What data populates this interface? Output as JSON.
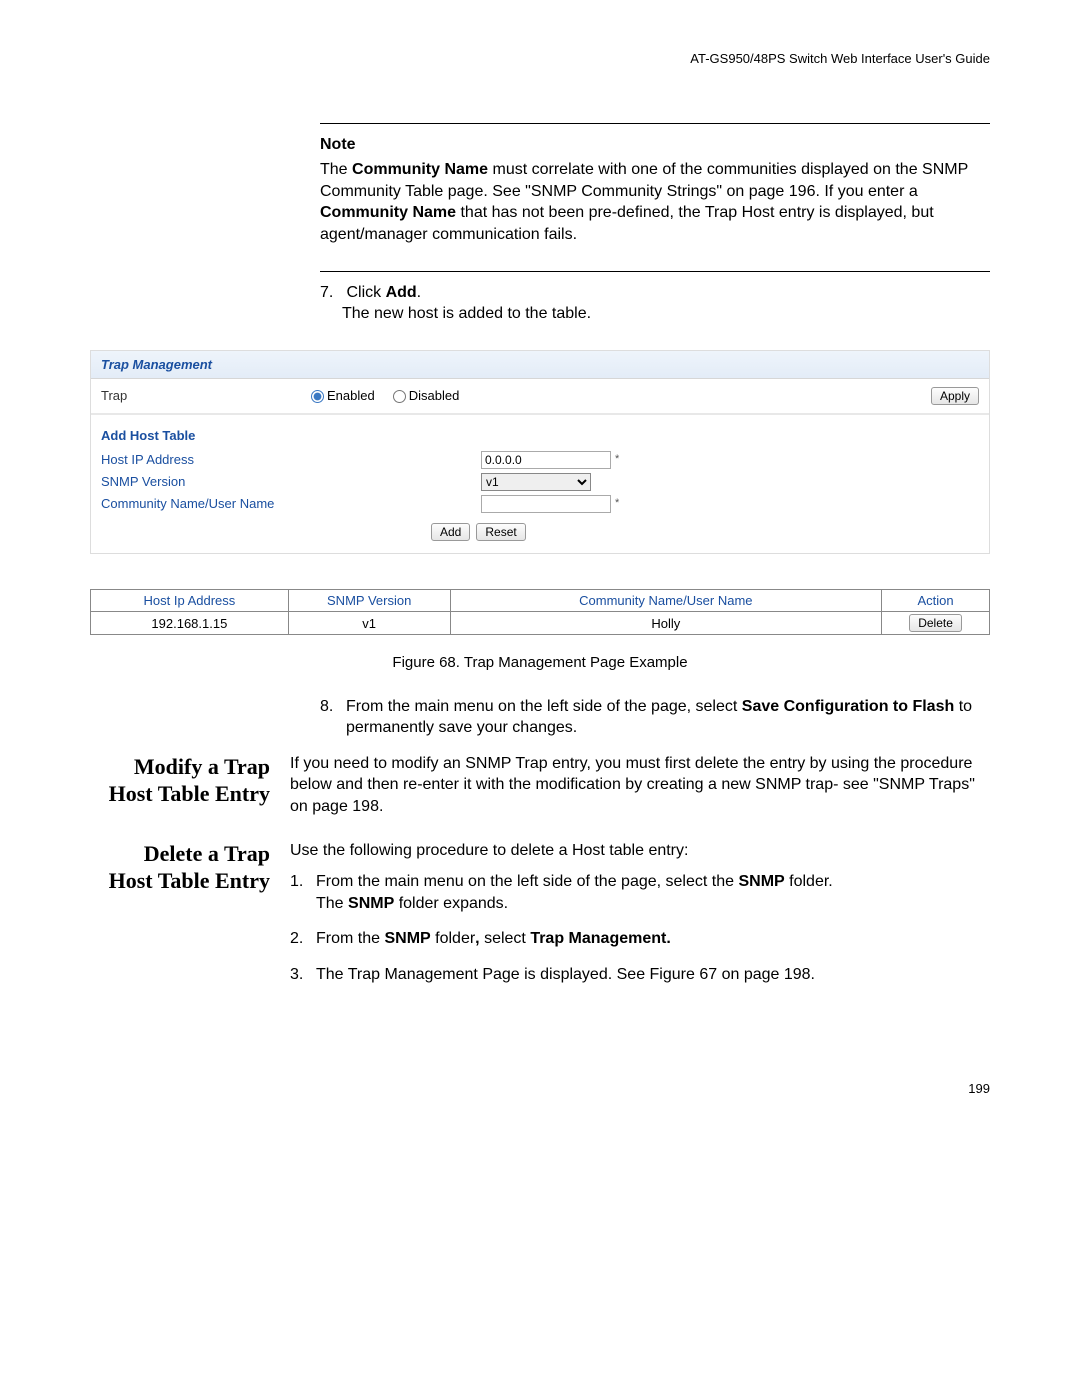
{
  "doc_header": "AT-GS950/48PS Switch Web Interface User's Guide",
  "note": {
    "title": "Note",
    "text_parts": {
      "p1": "The ",
      "b1": "Community Name",
      "p2": " must correlate with one of the communities displayed on the SNMP Community Table page. See \"SNMP Community Strings\" on page 196. If you enter a ",
      "b2": "Community Name",
      "p3": " that has not been pre-defined, the Trap Host entry is displayed, but agent/manager communication fails."
    }
  },
  "step7": {
    "num": "7.",
    "line1a": "Click ",
    "line1b": "Add",
    "line1c": ".",
    "line2": "The new host is added to the table."
  },
  "trap": {
    "title": "Trap Management",
    "trap_label": "Trap",
    "enabled": "Enabled",
    "disabled": "Disabled",
    "apply": "Apply",
    "add_host_title": "Add Host Table",
    "host_ip_label": "Host IP Address",
    "host_ip_value": "0.0.0.0",
    "snmp_version_label": "SNMP Version",
    "snmp_version_value": "v1",
    "community_label": "Community Name/User Name",
    "community_value": "",
    "add_btn": "Add",
    "reset_btn": "Reset",
    "req": "*"
  },
  "table": {
    "headers": {
      "h1": "Host Ip Address",
      "h2": "SNMP Version",
      "h3": "Community Name/User Name",
      "h4": "Action"
    },
    "row": {
      "c1": "192.168.1.15",
      "c2": "v1",
      "c3": "Holly",
      "c4": "Delete"
    }
  },
  "fig_caption": "Figure 68. Trap Management Page Example",
  "step8": {
    "num": "8.",
    "a": "From the main menu on the left side of the page, select ",
    "b1": "Save Configuration to Flash",
    "c": " to permanently save your changes."
  },
  "modify": {
    "heading_l1": "Modify a Trap",
    "heading_l2": "Host Table Entry",
    "text": "If you need to modify an SNMP Trap entry, you must first delete the entry by using the procedure below and then re-enter it with the modification by creating a new SNMP trap- see \"SNMP Traps\" on page 198."
  },
  "delete": {
    "heading_l1": "Delete a Trap",
    "heading_l2": "Host Table Entry",
    "intro": "Use the following procedure to delete a Host table entry:",
    "s1": {
      "n": "1.",
      "a": "From the main menu on the left side of the page, select the ",
      "b": "SNMP",
      "c": " folder.",
      "d1": "The ",
      "d2": "SNMP",
      "d3": " folder expands."
    },
    "s2": {
      "n": "2.",
      "a": "From the ",
      "b1": "SNMP",
      "c": " folder",
      "comma": ",",
      "d": " select ",
      "b2": "Trap Management."
    },
    "s3": {
      "n": "3.",
      "t": "The Trap Management Page is displayed. See Figure 67 on page 198."
    }
  },
  "page_num": "199"
}
